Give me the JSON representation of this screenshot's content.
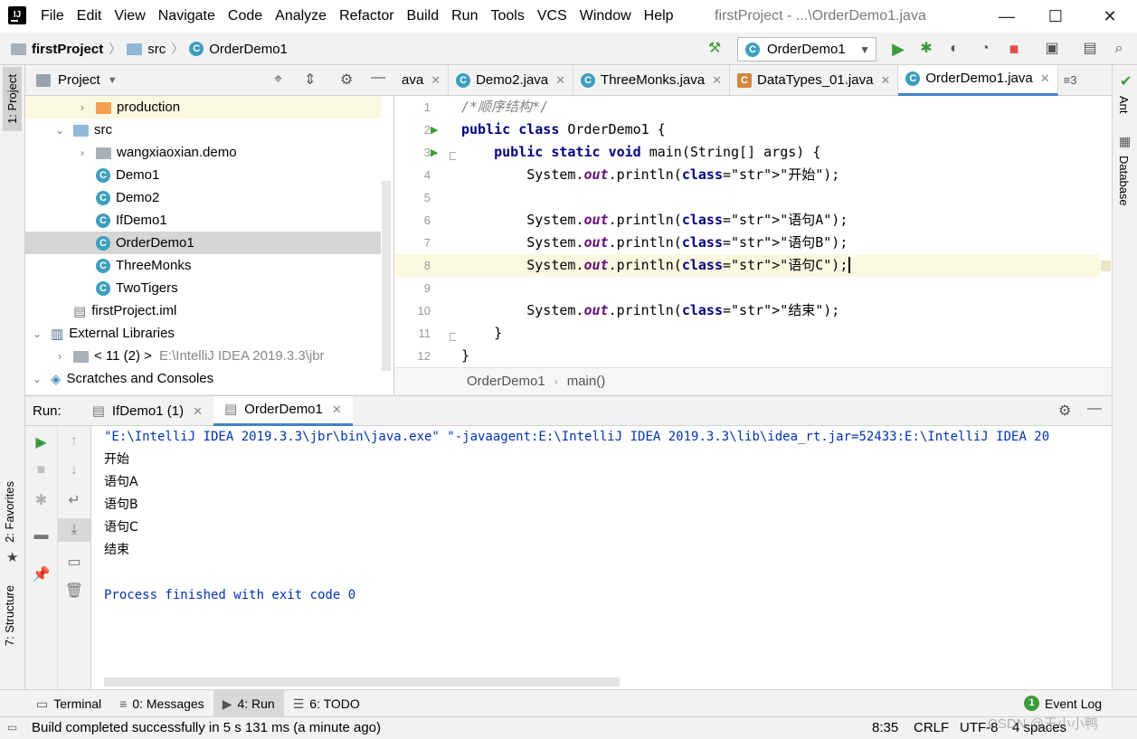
{
  "menu": [
    "File",
    "Edit",
    "View",
    "Navigate",
    "Code",
    "Analyze",
    "Refactor",
    "Build",
    "Run",
    "Tools",
    "VCS",
    "Window",
    "Help"
  ],
  "window_title": "firstProject - ...\\OrderDemo1.java",
  "nav": {
    "project": "firstProject",
    "folder": "src",
    "file": "OrderDemo1",
    "run_config": "OrderDemo1"
  },
  "left_stripe": {
    "project_tab": "1: Project",
    "favorites_tab": "2: Favorites",
    "structure_tab": "7: Structure"
  },
  "right_stripe": {
    "ant_tab": "Ant",
    "database_tab": "Database"
  },
  "project_panel": {
    "title": "Project",
    "tree": [
      {
        "label": "production",
        "indent": 2,
        "arrow": "›",
        "icon": "folder-orange"
      },
      {
        "label": "src",
        "indent": 1,
        "arrow": "⌄",
        "icon": "folder-blue"
      },
      {
        "label": "wangxiaoxian.demo",
        "indent": 2,
        "arrow": "›",
        "icon": "package"
      },
      {
        "label": "Demo1",
        "indent": 2,
        "arrow": "",
        "icon": "class"
      },
      {
        "label": "Demo2",
        "indent": 2,
        "arrow": "",
        "icon": "class"
      },
      {
        "label": "IfDemo1",
        "indent": 2,
        "arrow": "",
        "icon": "class"
      },
      {
        "label": "OrderDemo1",
        "indent": 2,
        "arrow": "",
        "icon": "class"
      },
      {
        "label": "ThreeMonks",
        "indent": 2,
        "arrow": "",
        "icon": "class"
      },
      {
        "label": "TwoTigers",
        "indent": 2,
        "arrow": "",
        "icon": "class"
      },
      {
        "label": "firstProject.iml",
        "indent": 1,
        "arrow": "",
        "icon": "file"
      },
      {
        "label": "External Libraries",
        "indent": 0,
        "arrow": "⌄",
        "icon": "library"
      },
      {
        "label": "< 11 (2) >",
        "suffix": "E:\\IntelliJ IDEA 2019.3.3\\jbr",
        "indent": 1,
        "arrow": "›",
        "icon": "folder-grey"
      },
      {
        "label": "Scratches and Consoles",
        "indent": 0,
        "arrow": "⌄",
        "icon": "scratch"
      }
    ]
  },
  "editor": {
    "tabs": [
      {
        "label": "ava",
        "active": false
      },
      {
        "label": "Demo2.java",
        "active": false
      },
      {
        "label": "ThreeMonks.java",
        "active": false
      },
      {
        "label": "DataTypes_01.java",
        "active": false
      },
      {
        "label": "OrderDemo1.java",
        "active": true
      }
    ],
    "tabs_overflow": "≡3",
    "lines": [
      {
        "n": "1",
        "text": "/*顺序结构*/"
      },
      {
        "n": "2",
        "text": "public class OrderDemo1 {"
      },
      {
        "n": "3",
        "text": "    public static void main(String[] args) {"
      },
      {
        "n": "4",
        "text": "        System.out.println(\"开始\");"
      },
      {
        "n": "5",
        "text": ""
      },
      {
        "n": "6",
        "text": "        System.out.println(\"语句A\");"
      },
      {
        "n": "7",
        "text": "        System.out.println(\"语句B\");"
      },
      {
        "n": "8",
        "text": "        System.out.println(\"语句C\");"
      },
      {
        "n": "9",
        "text": ""
      },
      {
        "n": "10",
        "text": "        System.out.println(\"结束\");"
      },
      {
        "n": "11",
        "text": "    }"
      },
      {
        "n": "12",
        "text": "}"
      }
    ],
    "breadcrumb": [
      "OrderDemo1",
      "main()"
    ]
  },
  "run_panel": {
    "label": "Run:",
    "tabs": [
      {
        "label": "IfDemo1 (1)",
        "active": false
      },
      {
        "label": "OrderDemo1",
        "active": true
      }
    ],
    "console": [
      {
        "text": "\"E:\\IntelliJ IDEA 2019.3.3\\jbr\\bin\\java.exe\" \"-javaagent:E:\\IntelliJ IDEA 2019.3.3\\lib\\idea_rt.jar=52433:E:\\IntelliJ IDEA 20",
        "kind": "cmd"
      },
      {
        "text": "开始",
        "kind": "out"
      },
      {
        "text": "语句A",
        "kind": "out"
      },
      {
        "text": "语句B",
        "kind": "out"
      },
      {
        "text": "语句C",
        "kind": "out"
      },
      {
        "text": "结束",
        "kind": "out"
      },
      {
        "text": "",
        "kind": "out"
      },
      {
        "text": "Process finished with exit code 0",
        "kind": "cmd"
      }
    ]
  },
  "bottom_tabs": [
    {
      "label": "Terminal",
      "active": false
    },
    {
      "label": "0: Messages",
      "active": false
    },
    {
      "label": "4: Run",
      "active": true
    },
    {
      "label": "6: TODO",
      "active": false
    }
  ],
  "event_log": {
    "badge": "1",
    "label": "Event Log"
  },
  "status": {
    "message": "Build completed successfully in 5 s 131 ms (a minute ago)",
    "position": "8:35",
    "line_sep": "CRLF",
    "encoding": "UTF-8",
    "indent": "4 spaces",
    "watermark": "CSDN @王小小鸭"
  },
  "colors": {
    "accent": "#4083c9",
    "run_green": "#3c9a3c",
    "stop_red": "#e05050",
    "keyword": "#000080",
    "string": "#008000",
    "field": "#660e7a"
  },
  "icons": [
    "app-logo-icon",
    "folder-icon",
    "class-icon",
    "hammer-icon",
    "run-icon",
    "debug-icon",
    "coverage-icon",
    "profile-icon",
    "stop-icon",
    "project-structure-icon",
    "search-icon",
    "target-icon",
    "collapse-icon",
    "gear-icon",
    "minimize-icon",
    "close-icon"
  ]
}
